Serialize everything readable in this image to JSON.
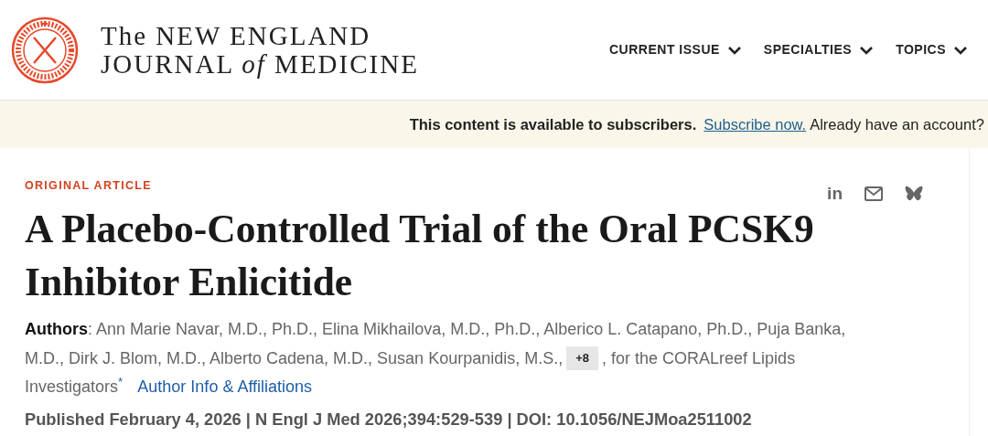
{
  "header": {
    "logo_lines": [
      "The NEW ENGLAND",
      "JOURNAL *of* MEDICINE"
    ],
    "nav": [
      {
        "label": "CURRENT ISSUE",
        "expanded": false
      },
      {
        "label": "SPECIALTIES",
        "expanded": false
      },
      {
        "label": "TOPICS",
        "expanded": false
      }
    ]
  },
  "banner": {
    "message": "This content is available to subscribers.",
    "link": "Subscribe now.",
    "rest": "Already have an account?"
  },
  "article": {
    "type": "ORIGINAL ARTICLE",
    "share": [
      {
        "kind": "linkedin",
        "glyph": "in"
      },
      {
        "kind": "email"
      },
      {
        "kind": "butterfly"
      }
    ],
    "title": "A Placebo-Controlled Trial of the Oral PCSK9 Inhibitor Enlicitide",
    "author_lines": [
      {
        "text": "**Authors**: Ann Marie Navar, M.D., Ph.D., Elina Mikhailova, M.D., Ph.D., Alberico L. Catapano, Ph.D., Puja Banka,"
      },
      {
        "text": "M.D., Dirk J. Blom, M.D., Alberto Cadena, M.D., Susan Kourpanidis, M.S.,",
        "more": "+8",
        "after": ", for the CORALreef Lipids"
      },
      {
        "text": "Investigators$^{*}$",
        "link": "Author Info & Affiliations"
      }
    ],
    "citation": "Published February 4, 2026 | N Engl J Med 2026;394:529-539 | DOI: 10.1056/NEJMoa2511002"
  }
}
